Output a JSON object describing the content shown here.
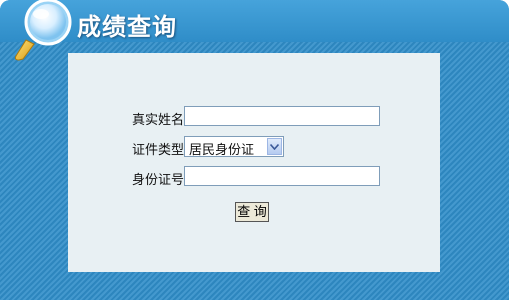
{
  "header": {
    "title": "成绩查询",
    "icon": "magnifier-icon"
  },
  "form": {
    "name_label": "真实姓名",
    "name_value": "",
    "id_type_label": "证件类型",
    "id_type_selected": "居民身份证",
    "id_number_label": "身份证号",
    "id_number_value": "",
    "submit_label": "查 询"
  },
  "colors": {
    "frame_blue": "#2f8dc8",
    "panel_bg": "#e8f0f3",
    "title_text": "#ffffff"
  }
}
